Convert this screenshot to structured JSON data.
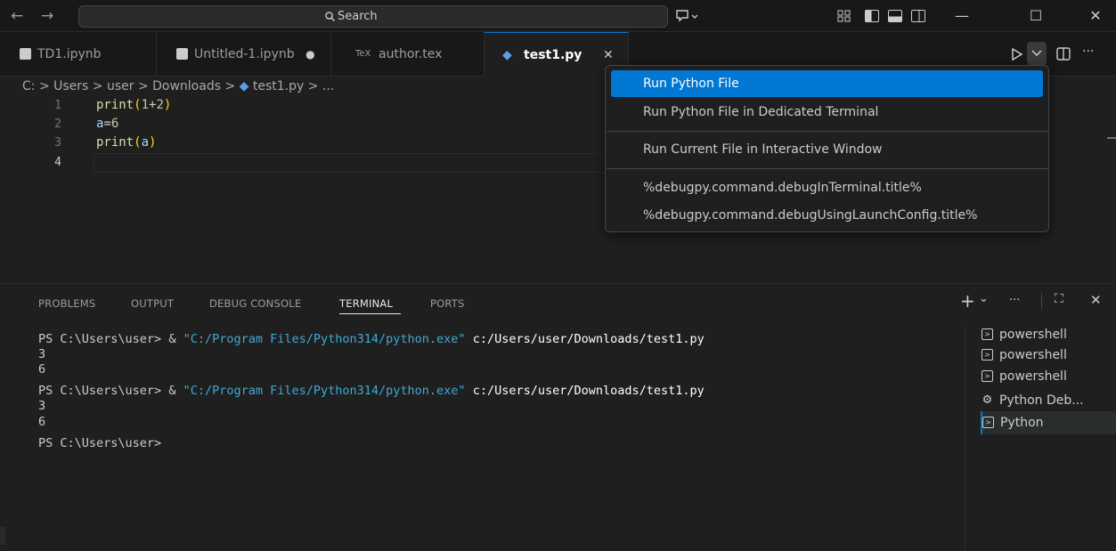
{
  "titlebar": {
    "back": "←",
    "forward": "→",
    "search_label": "Search",
    "copilot": "⌘",
    "minimize": "—",
    "maximize": "☐",
    "close": "✕"
  },
  "tabs": [
    {
      "label": "TD1.ipynb",
      "icon": "notebook-icon"
    },
    {
      "label": "Untitled-1.ipynb",
      "icon": "notebook-icon",
      "dirty": "●"
    },
    {
      "label": "author.tex",
      "icon": "tex-icon",
      "icon_text": "TeX"
    },
    {
      "label": "test1.py",
      "icon": "python-icon",
      "close": "✕"
    }
  ],
  "breadcrumb": "C: > Users > user > Downloads > ",
  "breadcrumb_file": "test1.py > ...",
  "editor": {
    "lines": [
      "1",
      "2",
      "3",
      "4"
    ]
  },
  "run_menu": {
    "items": [
      "Run Python File",
      "Run Python File in Dedicated Terminal",
      "Run Current File in Interactive Window",
      "%debugpy.command.debugInTerminal.title%",
      "%debugpy.command.debugUsingLaunchConfig.title%"
    ]
  },
  "panel": {
    "tabs": [
      "PROBLEMS",
      "OUTPUT",
      "DEBUG CONSOLE",
      "TERMINAL",
      "PORTS"
    ],
    "active_tab": "TERMINAL",
    "actions": {
      "add": "+",
      "dropdown": "⌄",
      "more": "···",
      "maximize": "⛶",
      "close": "✕"
    }
  },
  "terminal": {
    "prompt": "PS C:\\Users\\user> ",
    "amp": "& ",
    "exe": "\"C:/Program Files/Python314/python.exe\"",
    "script": " c:/Users/user/Downloads/test1.py",
    "out1": "3",
    "out2": "6",
    "final_prompt": "PS C:\\Users\\user>"
  },
  "terminal_list": [
    "powershell",
    "powershell",
    "powershell",
    "Python Deb...",
    "Python"
  ],
  "colors": {
    "accent": "#0078d4",
    "string": "#3dabd6",
    "function": "#dcdcaa",
    "number": "#b5cea8"
  }
}
